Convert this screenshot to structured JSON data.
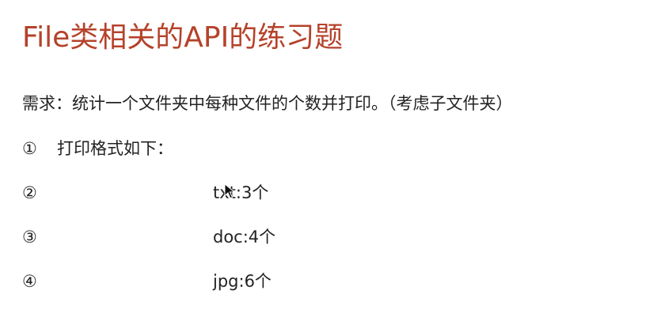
{
  "title": "File类相关的API的练习题",
  "requirement": "需求：统计一个文件夹中每种文件的个数并打印。（考虑子文件夹）",
  "items": [
    {
      "marker": "①",
      "text": "打印格式如下：",
      "code": ""
    },
    {
      "marker": "②",
      "text": "",
      "code": "txt:3个"
    },
    {
      "marker": "③",
      "text": "",
      "code": "doc:4个"
    },
    {
      "marker": "④",
      "text": "",
      "code": "jpg:6个"
    }
  ]
}
